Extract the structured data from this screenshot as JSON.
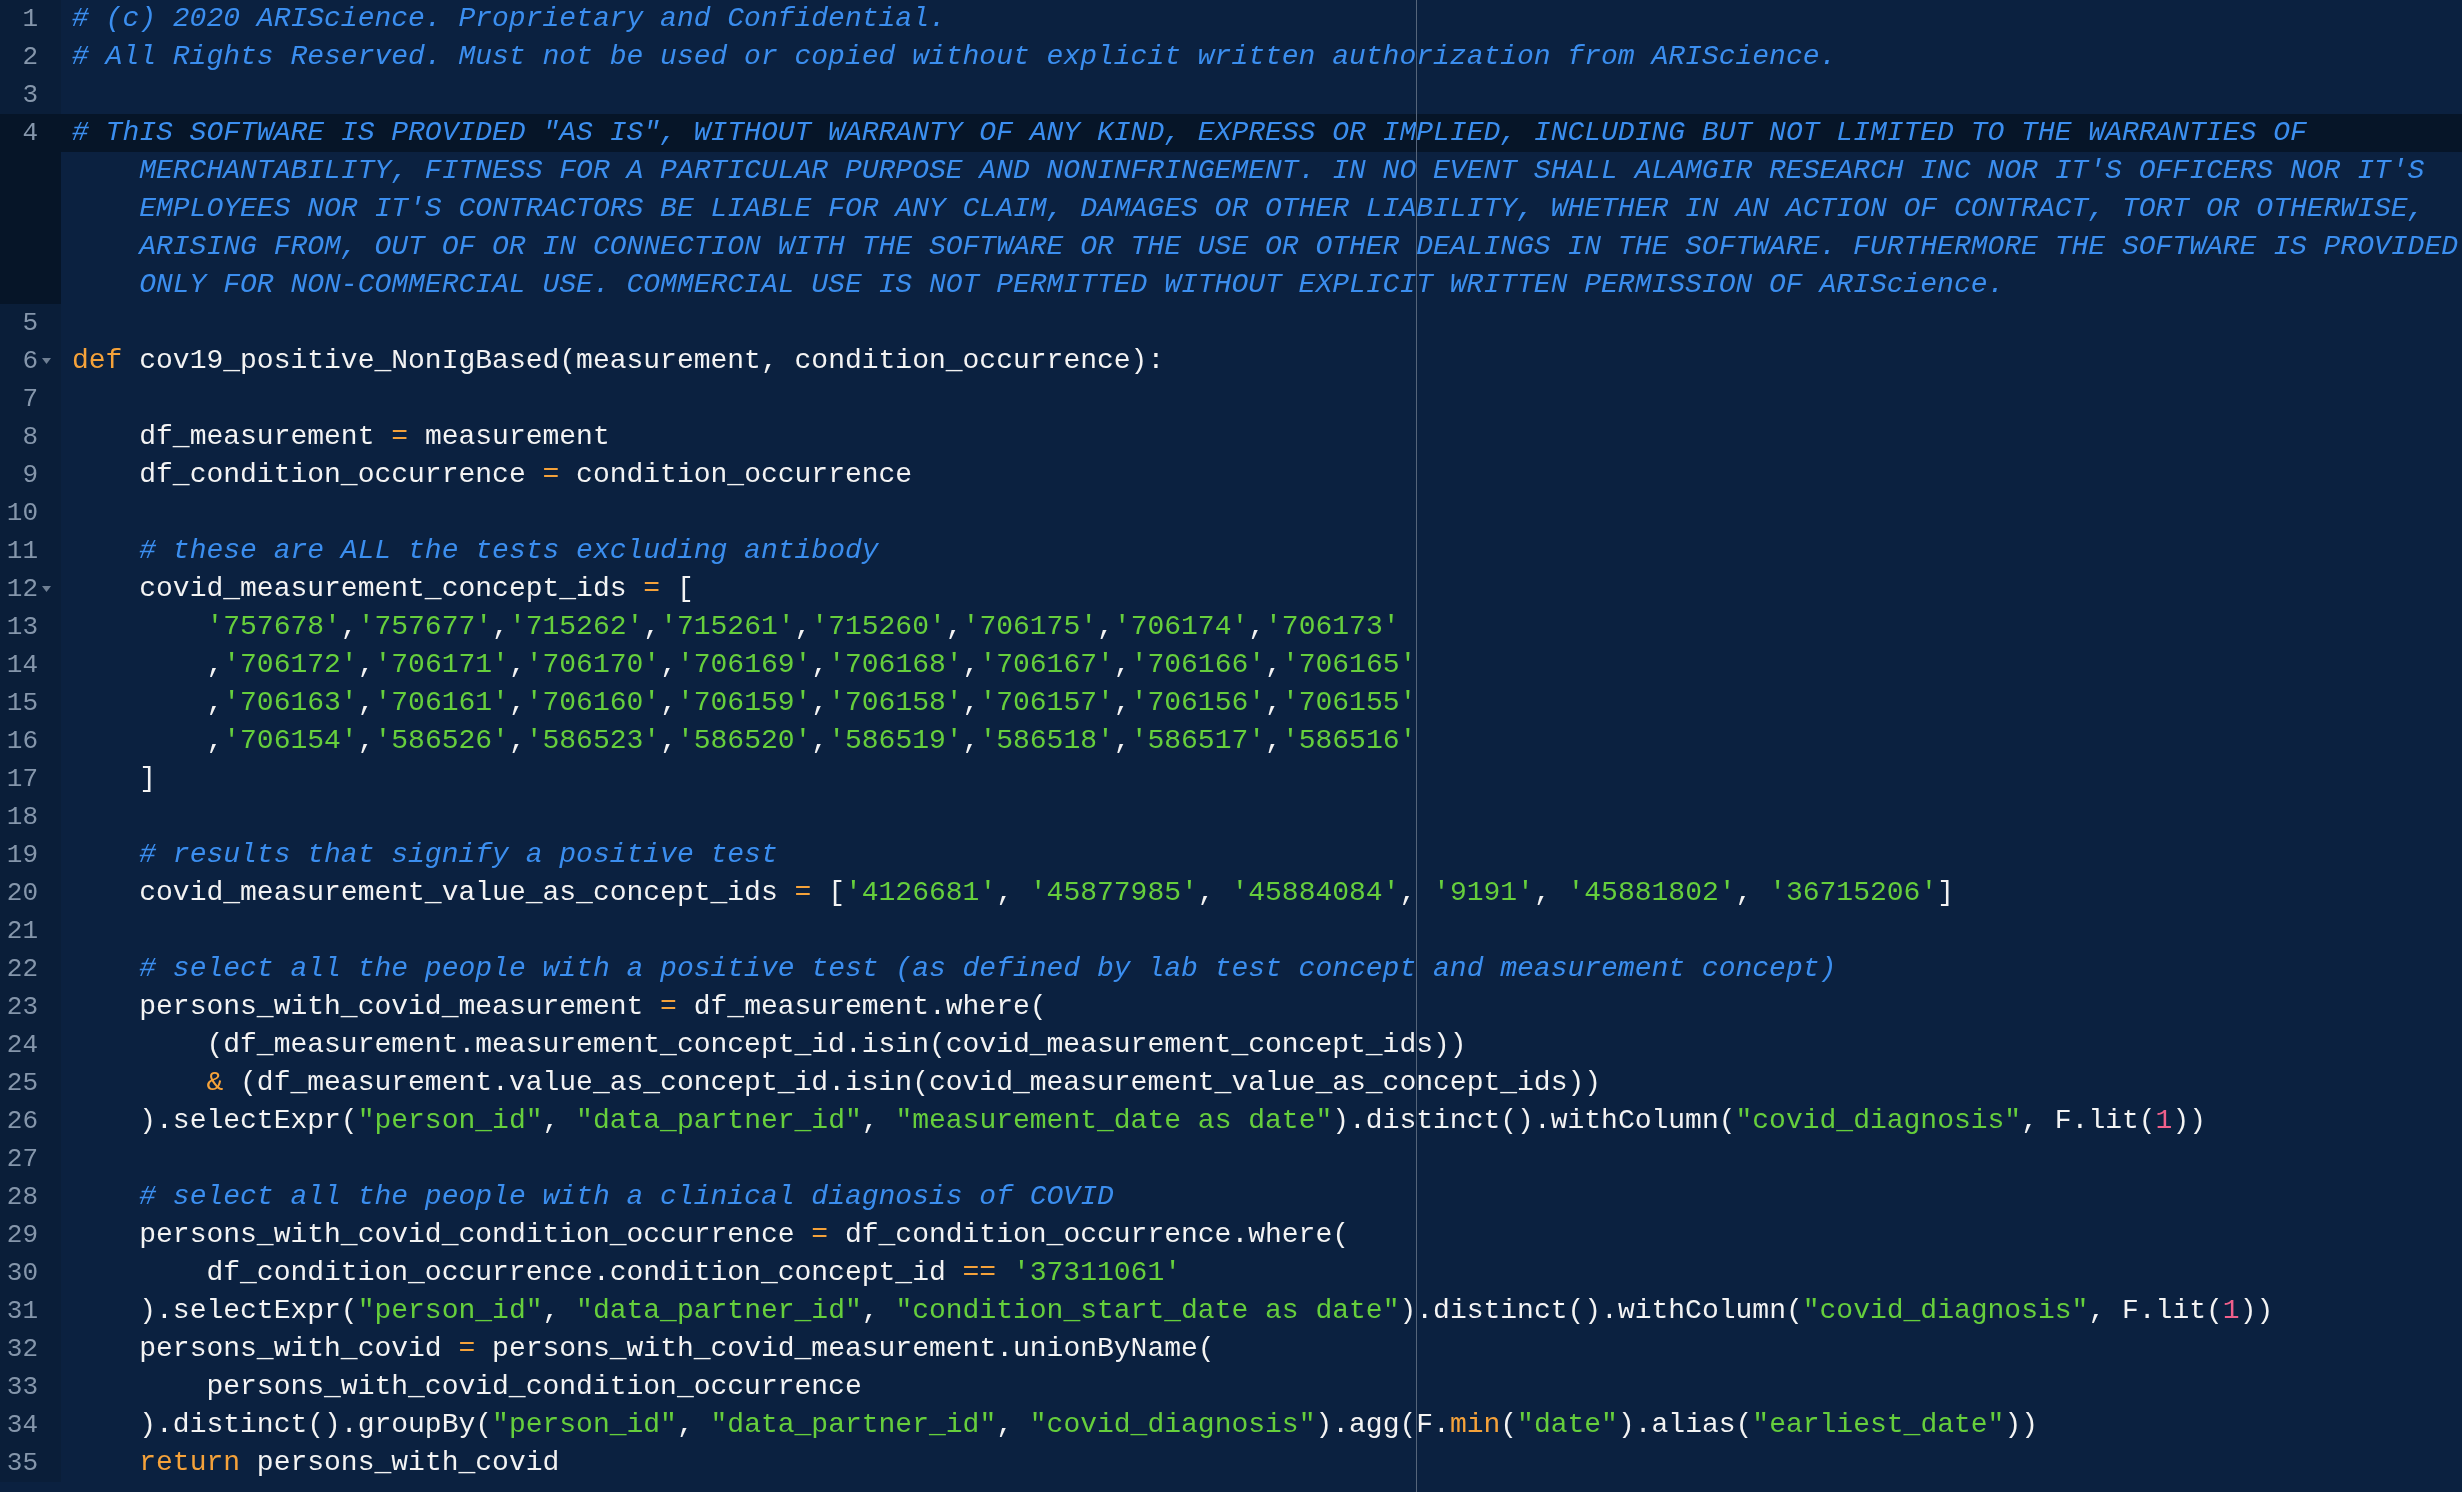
{
  "editor": {
    "lines": [
      {
        "number": "1",
        "tokens": [
          {
            "kind": "comment",
            "text": "# (c) 2020 ARIScience. Proprietary and Confidential."
          }
        ]
      },
      {
        "number": "2",
        "tokens": [
          {
            "kind": "comment",
            "text": "# All Rights Reserved. Must not be used or copied without explicit written authorization from ARIScience."
          }
        ]
      },
      {
        "number": "3"
      },
      {
        "number": "4",
        "active": true,
        "tokens": [
          {
            "kind": "comment",
            "text": "# ThIS SOFTWARE IS PROVIDED \"AS IS\", WITHOUT WARRANTY OF ANY KIND, EXPRESS OR IMPLIED, INCLUDING BUT NOT LIMITED TO THE WARRANTIES OF"
          }
        ],
        "wrapped_rows": [
          {
            "kind": "comment",
            "text": "MERCHANTABILITY, FITNESS FOR A PARTICULAR PURPOSE AND NONINFRINGEMENT. IN NO EVENT SHALL ALAMGIR RESEARCH INC NOR IT'S OFFICERS NOR IT'S"
          },
          {
            "kind": "comment",
            "text": "EMPLOYEES NOR IT'S CONTRACTORS BE LIABLE FOR ANY CLAIM, DAMAGES OR OTHER LIABILITY, WHETHER IN AN ACTION OF CONTRACT, TORT OR OTHERWISE,"
          },
          {
            "kind": "comment",
            "text": "ARISING FROM, OUT OF OR IN CONNECTION WITH THE SOFTWARE OR THE USE OR OTHER DEALINGS IN THE SOFTWARE. FURTHERMORE THE SOFTWARE IS PROVIDED"
          },
          {
            "kind": "comment",
            "text": "ONLY FOR NON-COMMERCIAL USE. COMMERCIAL USE IS NOT PERMITTED WITHOUT EXPLICIT WRITTEN PERMISSION OF ARIScience."
          }
        ]
      },
      {
        "number": "5"
      },
      {
        "number": "6",
        "fold": true,
        "tokens": [
          {
            "kind": "keyword",
            "text": "def"
          },
          {
            "kind": "text",
            "text": " cov19_positive_NonIgBased(measurement, condition_occurrence):"
          }
        ]
      },
      {
        "number": "7"
      },
      {
        "number": "8",
        "tokens": [
          {
            "kind": "text",
            "text": "    df_measurement "
          },
          {
            "kind": "operator",
            "text": "="
          },
          {
            "kind": "text",
            "text": " measurement"
          }
        ]
      },
      {
        "number": "9",
        "tokens": [
          {
            "kind": "text",
            "text": "    df_condition_occurrence "
          },
          {
            "kind": "operator",
            "text": "="
          },
          {
            "kind": "text",
            "text": " condition_occurrence"
          }
        ]
      },
      {
        "number": "10"
      },
      {
        "number": "11",
        "tokens": [
          {
            "kind": "comment",
            "text": "    # these are ALL the tests excluding antibody"
          }
        ]
      },
      {
        "number": "12",
        "fold": true,
        "tokens": [
          {
            "kind": "text",
            "text": "    covid_measurement_concept_ids "
          },
          {
            "kind": "operator",
            "text": "="
          },
          {
            "kind": "text",
            "text": " ["
          }
        ]
      },
      {
        "number": "13",
        "tokens": [
          {
            "kind": "string",
            "text": "        '757678'"
          },
          {
            "kind": "text",
            "text": ","
          },
          {
            "kind": "string",
            "text": "'757677'"
          },
          {
            "kind": "text",
            "text": ","
          },
          {
            "kind": "string",
            "text": "'715262'"
          },
          {
            "kind": "text",
            "text": ","
          },
          {
            "kind": "string",
            "text": "'715261'"
          },
          {
            "kind": "text",
            "text": ","
          },
          {
            "kind": "string",
            "text": "'715260'"
          },
          {
            "kind": "text",
            "text": ","
          },
          {
            "kind": "string",
            "text": "'706175'"
          },
          {
            "kind": "text",
            "text": ","
          },
          {
            "kind": "string",
            "text": "'706174'"
          },
          {
            "kind": "text",
            "text": ","
          },
          {
            "kind": "string",
            "text": "'706173'"
          }
        ]
      },
      {
        "number": "14",
        "tokens": [
          {
            "kind": "text",
            "text": "        ,"
          },
          {
            "kind": "string",
            "text": "'706172'"
          },
          {
            "kind": "text",
            "text": ","
          },
          {
            "kind": "string",
            "text": "'706171'"
          },
          {
            "kind": "text",
            "text": ","
          },
          {
            "kind": "string",
            "text": "'706170'"
          },
          {
            "kind": "text",
            "text": ","
          },
          {
            "kind": "string",
            "text": "'706169'"
          },
          {
            "kind": "text",
            "text": ","
          },
          {
            "kind": "string",
            "text": "'706168'"
          },
          {
            "kind": "text",
            "text": ","
          },
          {
            "kind": "string",
            "text": "'706167'"
          },
          {
            "kind": "text",
            "text": ","
          },
          {
            "kind": "string",
            "text": "'706166'"
          },
          {
            "kind": "text",
            "text": ","
          },
          {
            "kind": "string",
            "text": "'706165'"
          }
        ]
      },
      {
        "number": "15",
        "tokens": [
          {
            "kind": "text",
            "text": "        ,"
          },
          {
            "kind": "string",
            "text": "'706163'"
          },
          {
            "kind": "text",
            "text": ","
          },
          {
            "kind": "string",
            "text": "'706161'"
          },
          {
            "kind": "text",
            "text": ","
          },
          {
            "kind": "string",
            "text": "'706160'"
          },
          {
            "kind": "text",
            "text": ","
          },
          {
            "kind": "string",
            "text": "'706159'"
          },
          {
            "kind": "text",
            "text": ","
          },
          {
            "kind": "string",
            "text": "'706158'"
          },
          {
            "kind": "text",
            "text": ","
          },
          {
            "kind": "string",
            "text": "'706157'"
          },
          {
            "kind": "text",
            "text": ","
          },
          {
            "kind": "string",
            "text": "'706156'"
          },
          {
            "kind": "text",
            "text": ","
          },
          {
            "kind": "string",
            "text": "'706155'"
          }
        ]
      },
      {
        "number": "16",
        "tokens": [
          {
            "kind": "text",
            "text": "        ,"
          },
          {
            "kind": "string",
            "text": "'706154'"
          },
          {
            "kind": "text",
            "text": ","
          },
          {
            "kind": "string",
            "text": "'586526'"
          },
          {
            "kind": "text",
            "text": ","
          },
          {
            "kind": "string",
            "text": "'586523'"
          },
          {
            "kind": "text",
            "text": ","
          },
          {
            "kind": "string",
            "text": "'586520'"
          },
          {
            "kind": "text",
            "text": ","
          },
          {
            "kind": "string",
            "text": "'586519'"
          },
          {
            "kind": "text",
            "text": ","
          },
          {
            "kind": "string",
            "text": "'586518'"
          },
          {
            "kind": "text",
            "text": ","
          },
          {
            "kind": "string",
            "text": "'586517'"
          },
          {
            "kind": "text",
            "text": ","
          },
          {
            "kind": "string",
            "text": "'586516'"
          }
        ]
      },
      {
        "number": "17",
        "tokens": [
          {
            "kind": "text",
            "text": "    ]"
          }
        ]
      },
      {
        "number": "18"
      },
      {
        "number": "19",
        "tokens": [
          {
            "kind": "comment",
            "text": "    # results that signify a positive test"
          }
        ]
      },
      {
        "number": "20",
        "tokens": [
          {
            "kind": "text",
            "text": "    covid_measurement_value_as_concept_ids "
          },
          {
            "kind": "operator",
            "text": "="
          },
          {
            "kind": "text",
            "text": " ["
          },
          {
            "kind": "string",
            "text": "'4126681'"
          },
          {
            "kind": "text",
            "text": ", "
          },
          {
            "kind": "string",
            "text": "'45877985'"
          },
          {
            "kind": "text",
            "text": ", "
          },
          {
            "kind": "string",
            "text": "'45884084'"
          },
          {
            "kind": "text",
            "text": ", "
          },
          {
            "kind": "string",
            "text": "'9191'"
          },
          {
            "kind": "text",
            "text": ", "
          },
          {
            "kind": "string",
            "text": "'45881802'"
          },
          {
            "kind": "text",
            "text": ", "
          },
          {
            "kind": "string",
            "text": "'36715206'"
          },
          {
            "kind": "text",
            "text": "]"
          }
        ]
      },
      {
        "number": "21"
      },
      {
        "number": "22",
        "tokens": [
          {
            "kind": "comment",
            "text": "    # select all the people with a positive test (as defined by lab test concept and measurement concept)"
          }
        ]
      },
      {
        "number": "23",
        "tokens": [
          {
            "kind": "text",
            "text": "    persons_with_covid_measurement "
          },
          {
            "kind": "operator",
            "text": "="
          },
          {
            "kind": "text",
            "text": " df_measurement.where("
          }
        ]
      },
      {
        "number": "24",
        "tokens": [
          {
            "kind": "text",
            "text": "        (df_measurement.measurement_concept_id.isin(covid_measurement_concept_ids))"
          }
        ]
      },
      {
        "number": "25",
        "tokens": [
          {
            "kind": "operator",
            "text": "        &"
          },
          {
            "kind": "text",
            "text": " (df_measurement.value_as_concept_id.isin(covid_measurement_value_as_concept_ids))"
          }
        ]
      },
      {
        "number": "26",
        "tokens": [
          {
            "kind": "text",
            "text": "    ).selectExpr("
          },
          {
            "kind": "string",
            "text": "\"person_id\""
          },
          {
            "kind": "text",
            "text": ", "
          },
          {
            "kind": "string",
            "text": "\"data_partner_id\""
          },
          {
            "kind": "text",
            "text": ", "
          },
          {
            "kind": "string",
            "text": "\"measurement_date as date\""
          },
          {
            "kind": "text",
            "text": ").distinct().withColumn("
          },
          {
            "kind": "string",
            "text": "\"covid_diagnosis\""
          },
          {
            "kind": "text",
            "text": ", F.lit("
          },
          {
            "kind": "number",
            "text": "1"
          },
          {
            "kind": "text",
            "text": "))"
          }
        ]
      },
      {
        "number": "27"
      },
      {
        "number": "28",
        "tokens": [
          {
            "kind": "comment",
            "text": "    # select all the people with a clinical diagnosis of COVID"
          }
        ]
      },
      {
        "number": "29",
        "tokens": [
          {
            "kind": "text",
            "text": "    persons_with_covid_condition_occurrence "
          },
          {
            "kind": "operator",
            "text": "="
          },
          {
            "kind": "text",
            "text": " df_condition_occurrence.where("
          }
        ]
      },
      {
        "number": "30",
        "tokens": [
          {
            "kind": "text",
            "text": "        df_condition_occurrence.condition_concept_id "
          },
          {
            "kind": "operator",
            "text": "=="
          },
          {
            "kind": "string",
            "text": " '37311061'"
          }
        ]
      },
      {
        "number": "31",
        "tokens": [
          {
            "kind": "text",
            "text": "    ).selectExpr("
          },
          {
            "kind": "string",
            "text": "\"person_id\""
          },
          {
            "kind": "text",
            "text": ", "
          },
          {
            "kind": "string",
            "text": "\"data_partner_id\""
          },
          {
            "kind": "text",
            "text": ", "
          },
          {
            "kind": "string",
            "text": "\"condition_start_date as date\""
          },
          {
            "kind": "text",
            "text": ").distinct().withColumn("
          },
          {
            "kind": "string",
            "text": "\"covid_diagnosis\""
          },
          {
            "kind": "text",
            "text": ", F.lit("
          },
          {
            "kind": "number",
            "text": "1"
          },
          {
            "kind": "text",
            "text": "))"
          }
        ]
      },
      {
        "number": "32",
        "tokens": [
          {
            "kind": "text",
            "text": "    persons_with_covid "
          },
          {
            "kind": "operator",
            "text": "="
          },
          {
            "kind": "text",
            "text": " persons_with_covid_measurement.unionByName("
          }
        ]
      },
      {
        "number": "33",
        "tokens": [
          {
            "kind": "text",
            "text": "        persons_with_covid_condition_occurrence"
          }
        ]
      },
      {
        "number": "34",
        "tokens": [
          {
            "kind": "text",
            "text": "    ).distinct().groupBy("
          },
          {
            "kind": "string",
            "text": "\"person_id\""
          },
          {
            "kind": "text",
            "text": ", "
          },
          {
            "kind": "string",
            "text": "\"data_partner_id\""
          },
          {
            "kind": "text",
            "text": ", "
          },
          {
            "kind": "string",
            "text": "\"covid_diagnosis\""
          },
          {
            "kind": "text",
            "text": ").agg(F."
          },
          {
            "kind": "keyword",
            "text": "min"
          },
          {
            "kind": "text",
            "text": "("
          },
          {
            "kind": "string",
            "text": "\"date\""
          },
          {
            "kind": "text",
            "text": ").alias("
          },
          {
            "kind": "string",
            "text": "\"earliest_date\""
          },
          {
            "kind": "text",
            "text": "))"
          }
        ]
      },
      {
        "number": "35",
        "tokens": [
          {
            "kind": "keyword",
            "text": "    return"
          },
          {
            "kind": "text",
            "text": " persons_with_covid"
          }
        ]
      }
    ]
  }
}
